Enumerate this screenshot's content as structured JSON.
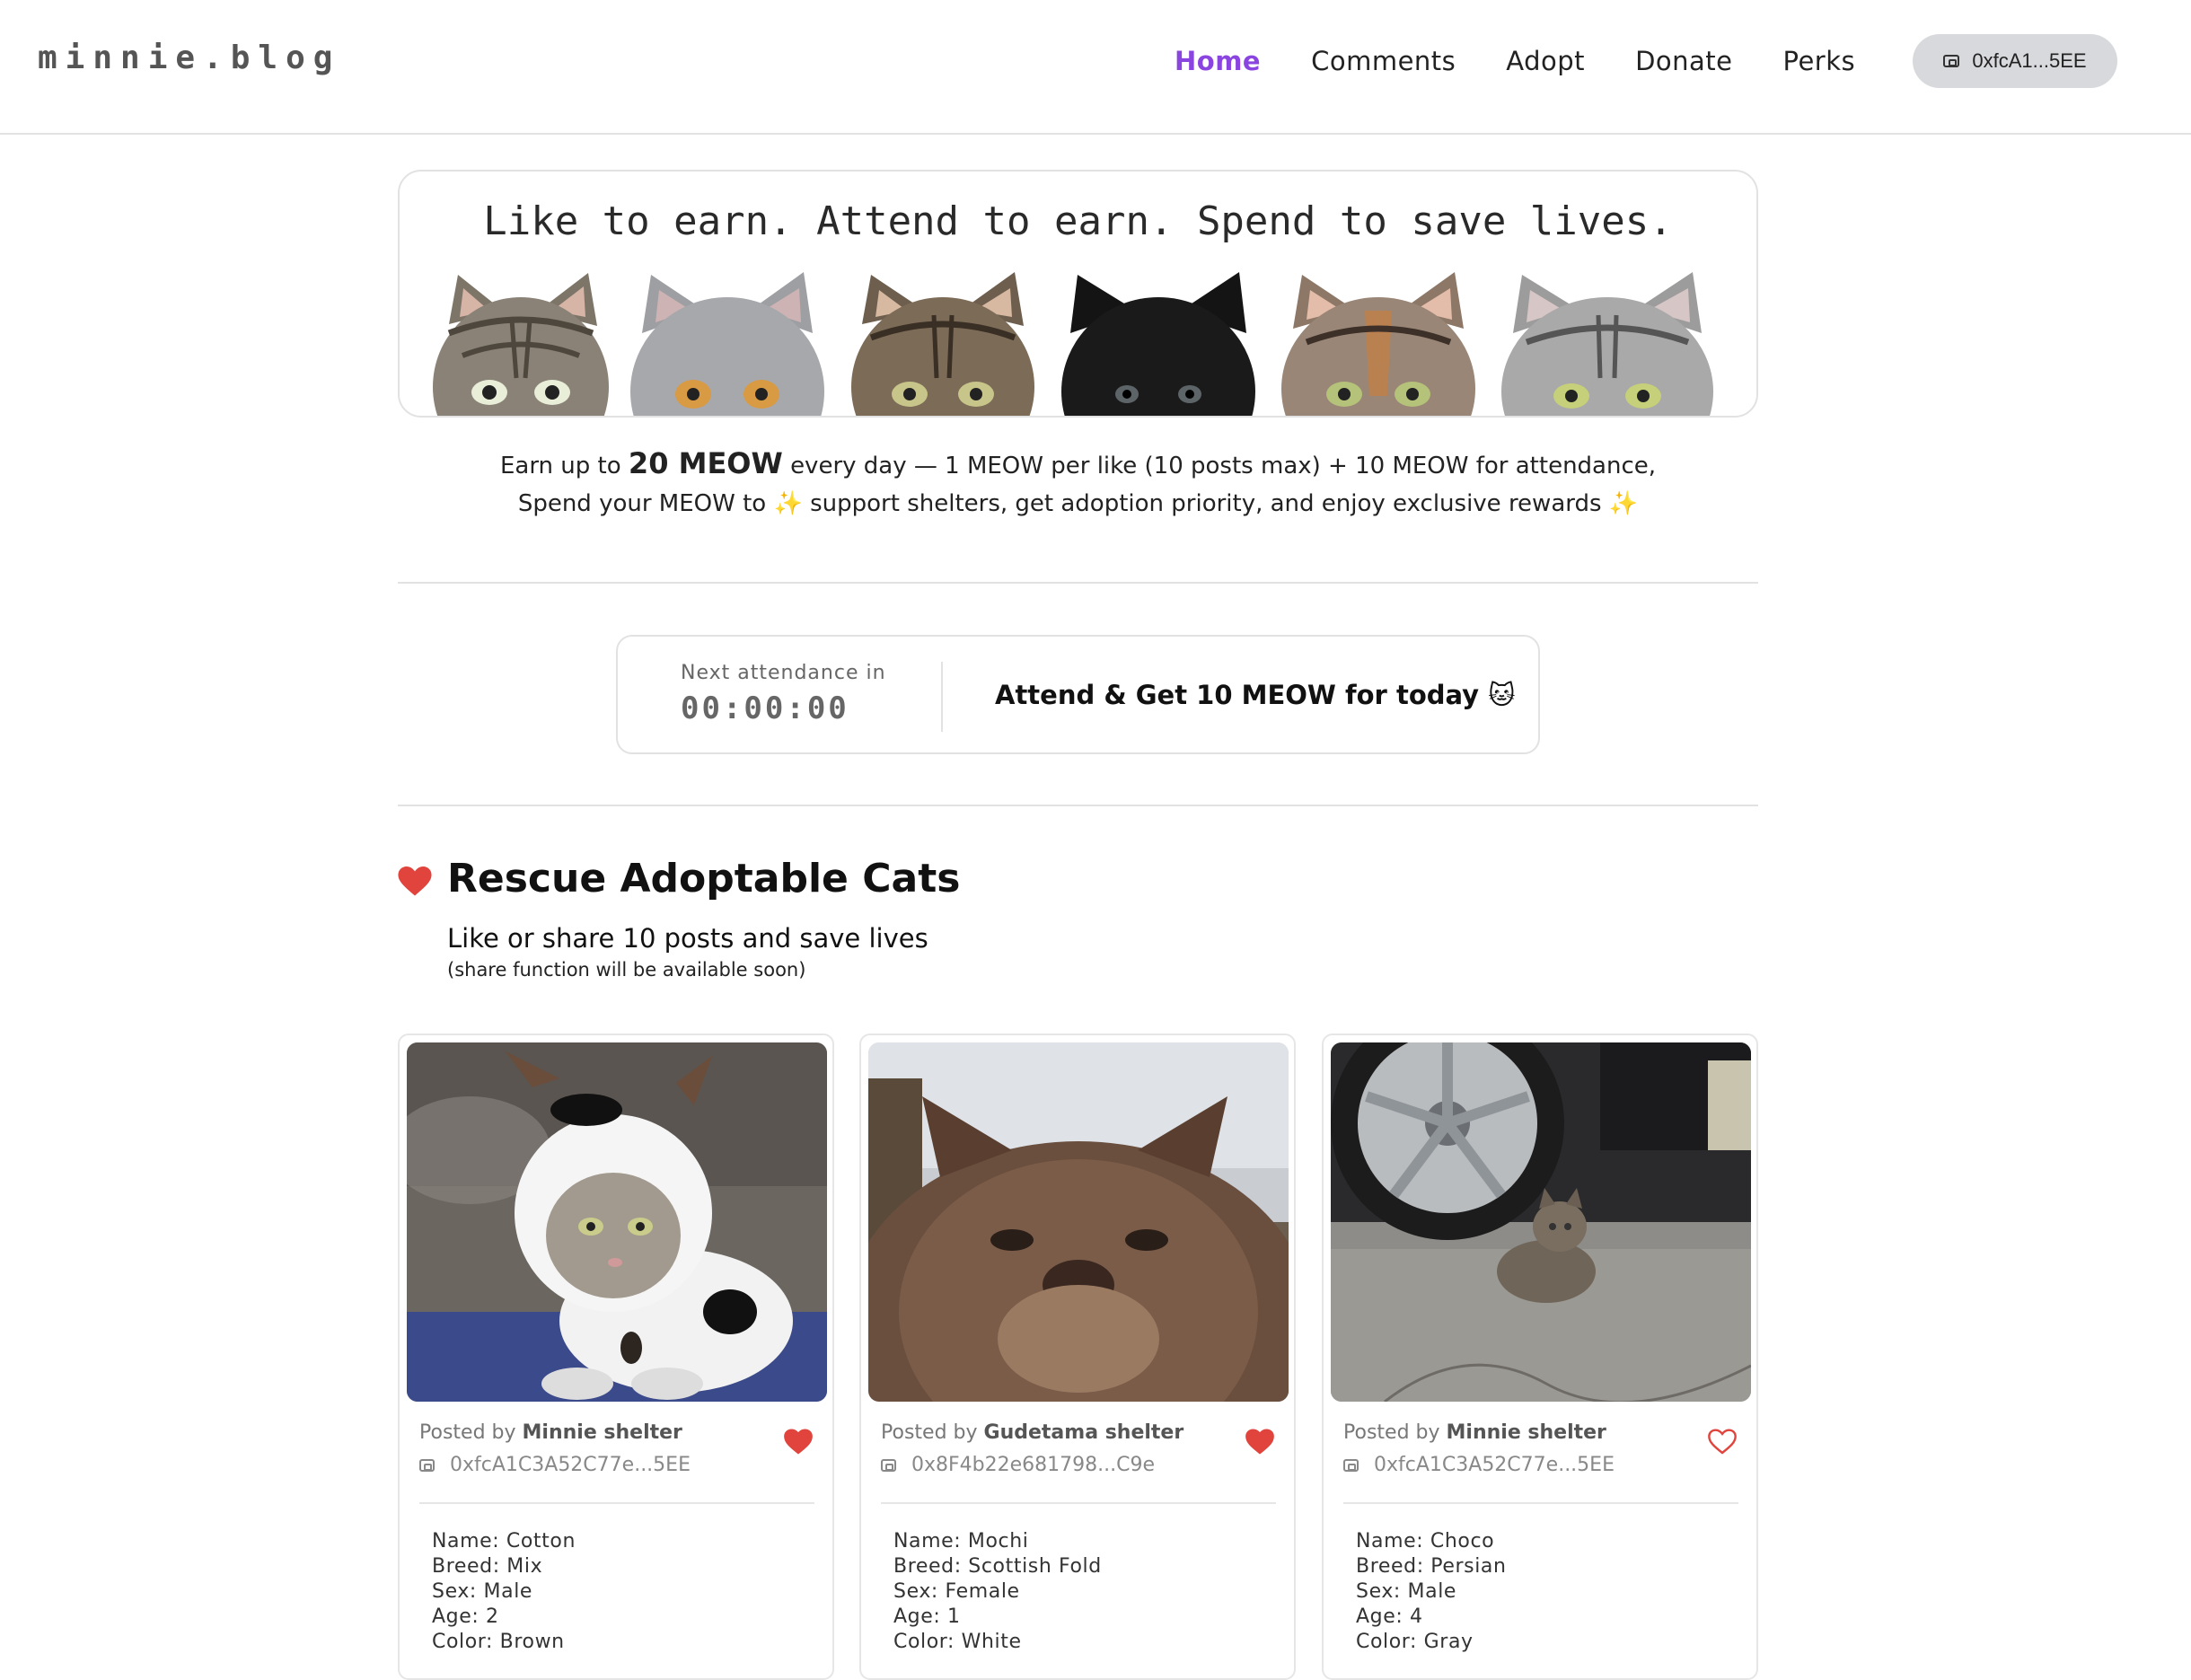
{
  "nav": {
    "logo": "minnie.blog",
    "links": [
      "Home",
      "Comments",
      "Adopt",
      "Donate",
      "Perks"
    ],
    "active": "Home",
    "wallet": "0xfcA1...5EE"
  },
  "hero": {
    "title": "Like to earn. Attend to earn. Spend to save lives.",
    "tagline_prefix": "Earn up to",
    "tagline_amount": "20 MEOW",
    "tagline_suffix": "every day — 1 MEOW per like (10 posts max) + 10 MEOW for attendance,",
    "tagline_line2_a": "Spend your MEOW to",
    "tagline_line2_b": "support shelters, get adoption priority, and enjoy exclusive rewards",
    "sparkle": "✨"
  },
  "attendance": {
    "label": "Next attendance in",
    "timer": "00:00:00",
    "button": "Attend & Get 10 MEOW for today",
    "button_emoji": "🐱"
  },
  "section": {
    "title": "Rescue Adoptable Cats",
    "subtitle": "Like or share 10 posts and save lives",
    "note": "(share function will be available soon)"
  },
  "cards": [
    {
      "posted_by_label": "Posted by",
      "shelter": "Minnie shelter",
      "address": "0xfcA1C3A52C77e...5EE",
      "liked": true,
      "name": "Name: Cotton",
      "breed": "Breed: Mix",
      "sex": "Sex: Male",
      "age": "Age: 2",
      "color": "Color: Brown"
    },
    {
      "posted_by_label": "Posted by",
      "shelter": "Gudetama shelter",
      "address": "0x8F4b22e681798...C9e",
      "liked": true,
      "name": "Name: Mochi",
      "breed": "Breed: Scottish Fold",
      "sex": "Sex: Female",
      "age": "Age: 1",
      "color": "Color: White"
    },
    {
      "posted_by_label": "Posted by",
      "shelter": "Minnie shelter",
      "address": "0xfcA1C3A52C77e...5EE",
      "liked": false,
      "name": "Name: Choco",
      "breed": "Breed: Persian",
      "sex": "Sex: Male",
      "age": "Age: 4",
      "color": "Color: Gray"
    }
  ],
  "colors": {
    "accent": "#8a45e0",
    "heart": "#e0443c",
    "border": "#e2e2e2",
    "wallet_bg": "#d8d9dc"
  }
}
